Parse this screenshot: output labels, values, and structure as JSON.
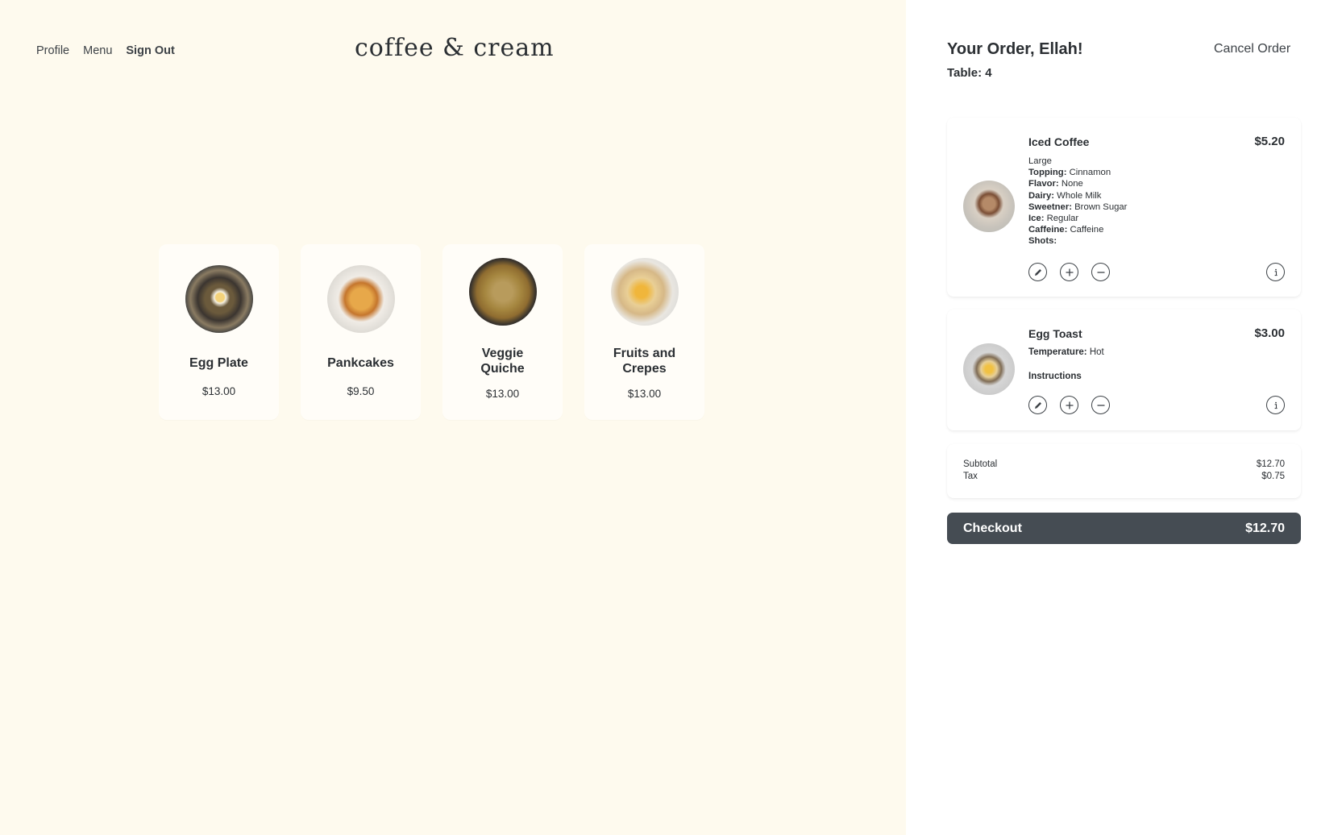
{
  "nav": {
    "profile": "Profile",
    "menu": "Menu",
    "sign_out": "Sign Out"
  },
  "brand": "coffee & cream",
  "menu_items": [
    {
      "name": "Egg Plate",
      "price": "$13.00"
    },
    {
      "name": "Pankcakes",
      "price": "$9.50"
    },
    {
      "name": "Veggie Quiche",
      "price": "$13.00"
    },
    {
      "name": "Fruits and Crepes",
      "price": "$13.00"
    }
  ],
  "order": {
    "title": "Your Order, Ellah!",
    "table": "Table: 4",
    "cancel_label": "Cancel Order",
    "items": [
      {
        "name": "Iced Coffee",
        "price": "$5.20",
        "size": "Large",
        "details": [
          {
            "label": "Topping:",
            "value": "Cinnamon"
          },
          {
            "label": "Flavor:",
            "value": "None"
          },
          {
            "label": "Dairy:",
            "value": "Whole Milk"
          },
          {
            "label": "Sweetner:",
            "value": "Brown Sugar"
          },
          {
            "label": "Ice:",
            "value": "Regular"
          },
          {
            "label": "Caffeine:",
            "value": "Caffeine"
          },
          {
            "label": "Shots:",
            "value": ""
          }
        ]
      },
      {
        "name": "Egg Toast",
        "price": "$3.00",
        "temperature_label": "Temperature:",
        "temperature_value": "Hot",
        "instructions_label": "Instructions"
      }
    ],
    "icons": {
      "edit": "pencil-icon",
      "add": "plus-icon",
      "remove": "minus-icon",
      "info": "info-icon"
    },
    "subtotal_label": "Subtotal",
    "subtotal_value": "$12.70",
    "tax_label": "Tax",
    "tax_value": "$0.75",
    "checkout_label": "Checkout",
    "checkout_total": "$12.70"
  },
  "colors": {
    "left_bg": "#fefaee",
    "checkout_bg": "#454c53",
    "text": "#2b2f33"
  }
}
